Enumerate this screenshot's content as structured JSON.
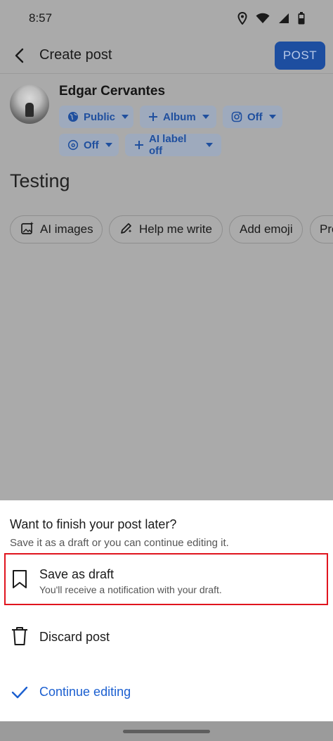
{
  "status_bar": {
    "time": "8:57",
    "icons": [
      "location-icon",
      "wifi-icon",
      "signal-icon",
      "battery-icon"
    ]
  },
  "app_bar": {
    "title": "Create post",
    "post_button": "POST"
  },
  "composer": {
    "user_name": "Edgar Cervantes",
    "chips": {
      "audience": "Public",
      "album": "Album",
      "instagram": "Off",
      "threads": "Off",
      "ai_label": "AI label off"
    },
    "post_text": "Testing",
    "suggestions": {
      "ai_images": "AI images",
      "help_me_write": "Help me write",
      "add_emoji": "Add emoji",
      "more": "Pro"
    }
  },
  "sheet": {
    "heading": "Want to finish your post later?",
    "subheading": "Save it as a draft or you can continue editing it.",
    "save_draft": {
      "label": "Save as draft",
      "description": "You'll receive a notification with your draft."
    },
    "discard": {
      "label": "Discard post"
    },
    "continue": {
      "label": "Continue editing"
    }
  },
  "colors": {
    "accent": "#1b5fd0",
    "post_button_bg": "#1d4ea0",
    "highlight_outline": "#e0141e",
    "dim_overlay": "#aaaaaa"
  }
}
